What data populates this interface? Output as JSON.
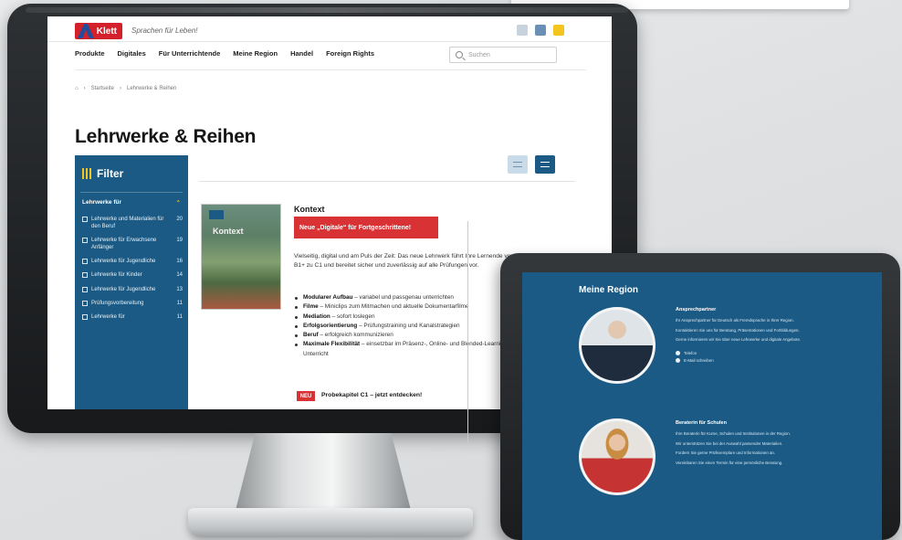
{
  "site": {
    "logo_text": "Klett",
    "tagline": "Sprachen für Leben!",
    "nav": [
      "Produkte",
      "Digitales",
      "Für Unterrichtende",
      "Meine Region",
      "Handel",
      "Foreign Rights"
    ],
    "search_placeholder": "Suchen",
    "breadcrumb": [
      "Startseite",
      "Lehrwerke & Reihen"
    ],
    "page_title": "Lehrwerke & Reihen"
  },
  "filter": {
    "title": "Filter",
    "group_label": "Lehrwerke für",
    "items": [
      {
        "label": "Lehrwerke und Materialien für den Beruf",
        "count": "20"
      },
      {
        "label": "Lehrwerke für Erwachsene Anfänger",
        "count": "19"
      },
      {
        "label": "Lehrwerke für Jugendliche",
        "count": "16"
      },
      {
        "label": "Lehrwerke für Kinder",
        "count": "14"
      },
      {
        "label": "Lehrwerke für Jugendliche",
        "count": "13"
      },
      {
        "label": "Prüfungsvorbereitung",
        "count": "11"
      },
      {
        "label": "Lehrwerke für",
        "count": "11"
      }
    ]
  },
  "product": {
    "cover_title": "Kontext",
    "title": "Kontext",
    "badge": "Neue „Digitale“ für Fortgeschrittene!",
    "description": "Vielseitig, digital und am Puls der Zeit: Das neue Lehrwerk führt Ihre Lernende von B1+ zu C1 und bereitet sicher und zuverlässig auf alle Prüfungen vor.",
    "bullets": [
      {
        "bold": "Modularer Aufbau",
        "text": " – variabel und passgenau unterrichten"
      },
      {
        "bold": "Filme",
        "text": " – Miniclips zum Mitmachen und aktuelle Dokumentarfilme"
      },
      {
        "bold": "Mediation",
        "text": " – sofort loslegen"
      },
      {
        "bold": "Erfolgsorientierung",
        "text": " – Prüfungstraining und Kanalstrategien"
      },
      {
        "bold": "Beruf",
        "text": " – erfolgreich kommunizieren"
      },
      {
        "bold": "Maximale Flexibilität",
        "text": " – einsetzbar im Präsenz-, Online- und Blended-Learning-Unterricht"
      }
    ],
    "new_label": "NEU",
    "preview_link": "Probekapitel C1 – jetzt entdecken!"
  },
  "tablet": {
    "title": "Meine Region",
    "contacts": [
      {
        "heading": "Ansprechpartner",
        "lines": [
          "Ihr Ansprechpartner für Deutsch als Fremdsprache in Ihrer Region.",
          "Kontaktieren Sie uns für Beratung, Präsentationen und Fortbildungen.",
          "Gerne informieren wir Sie über neue Lehrwerke und digitale Angebote."
        ],
        "phone": "Telefon",
        "email": "E-Mail schreiben"
      },
      {
        "heading": "Beraterin für Schulen",
        "lines": [
          "Ihre Beraterin für Kurse, Schulen und Institutionen in der Region.",
          "Wir unterstützen Sie bei der Auswahl passender Materialien.",
          "Fordern Sie gerne Prüfexemplare und Informationen an.",
          "Vereinbaren Sie einen Termin für eine persönliche Beratung."
        ]
      }
    ]
  },
  "colors": {
    "brand_blue": "#1a5a84",
    "brand_red": "#d3202a",
    "accent_yellow": "#f4c41f"
  }
}
